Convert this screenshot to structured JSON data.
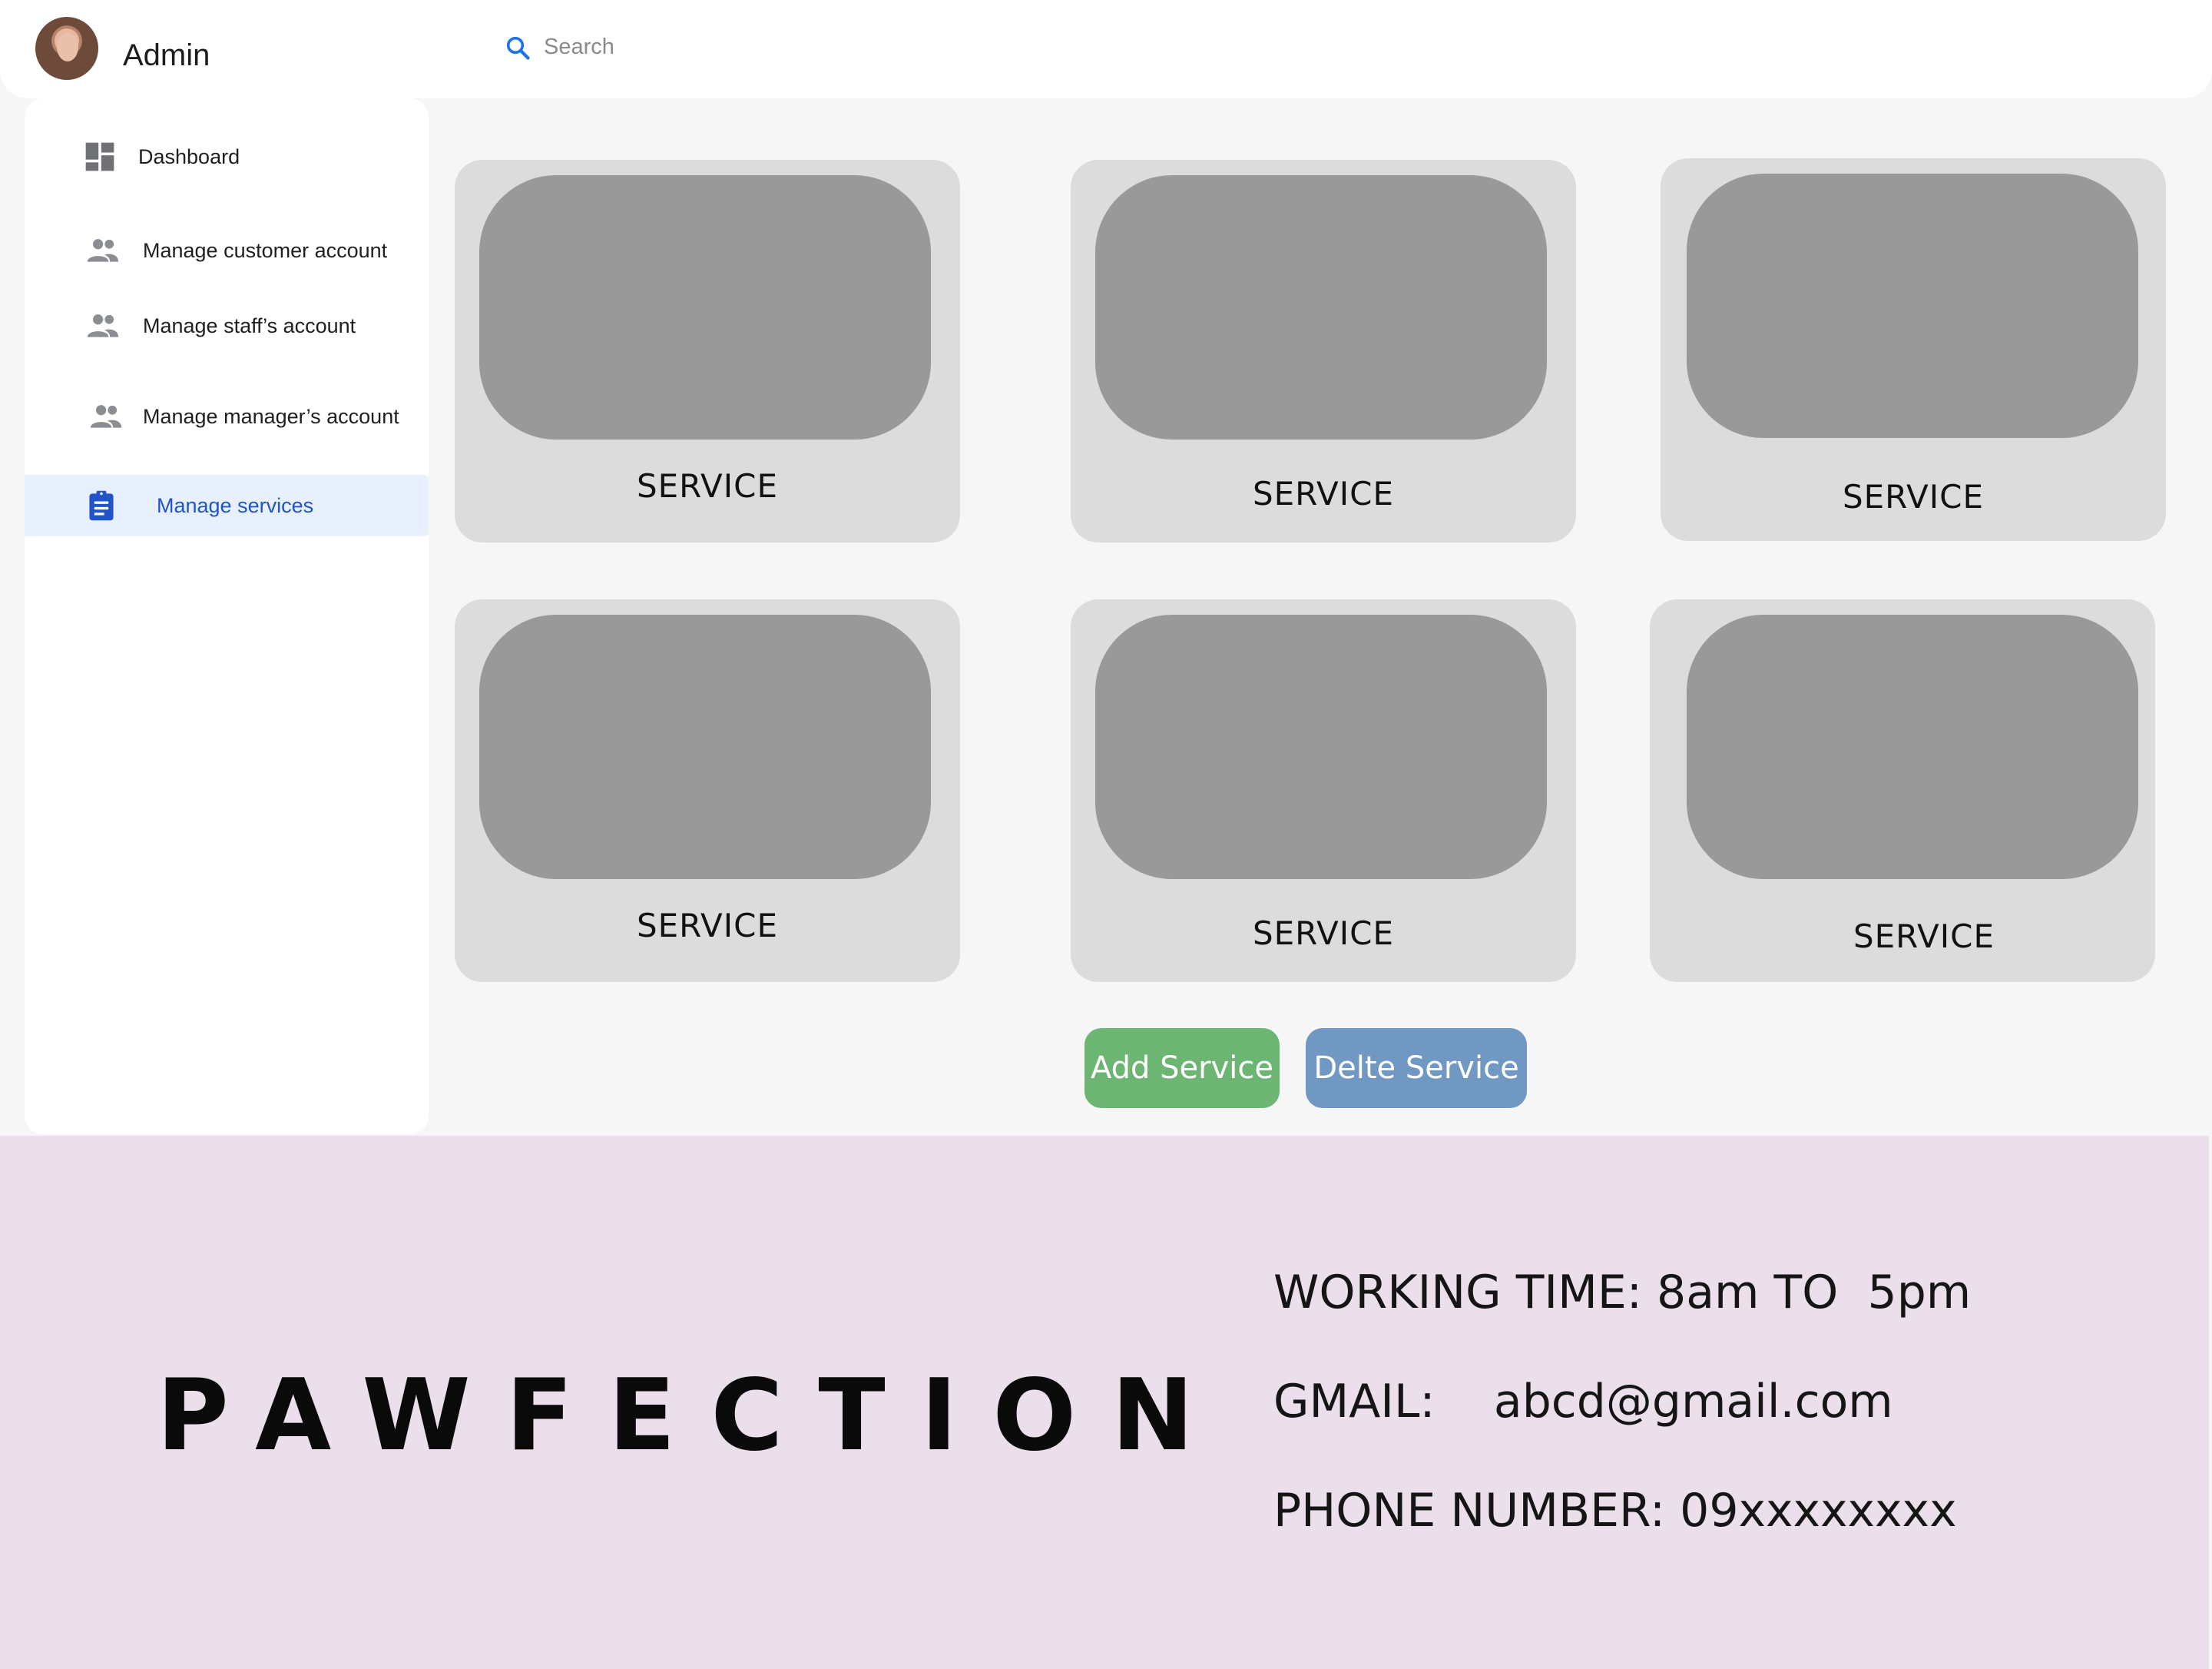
{
  "header": {
    "user_name": "Admin",
    "search": {
      "placeholder": "Search",
      "value": ""
    }
  },
  "sidebar": {
    "items": [
      {
        "label": "Dashboard",
        "icon": "dashboard-icon",
        "active": false
      },
      {
        "label": "Manage customer account",
        "icon": "people-icon",
        "active": false
      },
      {
        "label": "Manage staff’s account",
        "icon": "people-icon",
        "active": false
      },
      {
        "label": "Manage manager’s account",
        "icon": "people-icon",
        "active": false
      },
      {
        "label": "Manage services",
        "icon": "clipboard-icon",
        "active": true
      }
    ]
  },
  "services": {
    "cards": [
      {
        "label": "SERVICE"
      },
      {
        "label": "SERVICE"
      },
      {
        "label": "SERVICE"
      },
      {
        "label": "SERVICE"
      },
      {
        "label": "SERVICE"
      },
      {
        "label": "SERVICE"
      }
    ],
    "add_label": "Add Service",
    "delete_label": "Delte Service"
  },
  "footer": {
    "brand": "PAWFECTION",
    "working_time": "WORKING TIME: 8am TO  5pm",
    "gmail": "GMAIL:    abcd@gmail.com",
    "phone": "PHONE NUMBER: 09xxxxxxxx"
  },
  "colors": {
    "accent": "#1f55c8",
    "active_bg": "#e8f0fe",
    "add_button": "#6db572",
    "delete_button": "#7198c2",
    "footer_bg": "#eadfea",
    "card_bg": "#dcdcdc",
    "thumb_bg": "#999999"
  }
}
